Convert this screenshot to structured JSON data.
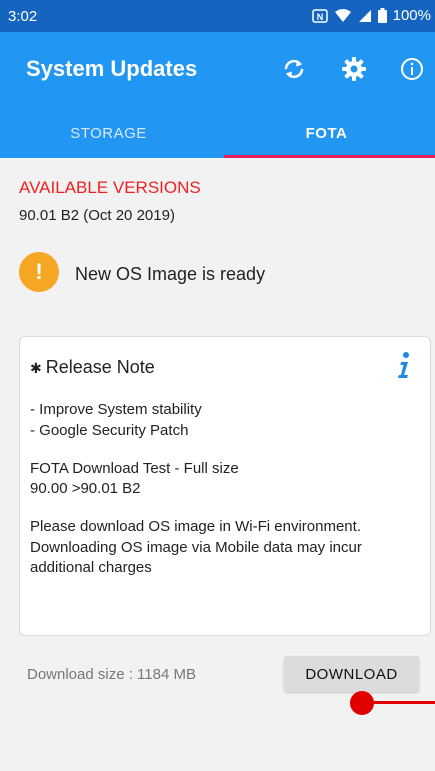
{
  "status_bar": {
    "time": "3:02",
    "battery": "100%"
  },
  "app_bar": {
    "title": "System Updates",
    "icons": [
      "sync-icon",
      "gear-icon",
      "info-icon"
    ]
  },
  "tabs": [
    {
      "label": "STORAGE",
      "active": false
    },
    {
      "label": "FOTA",
      "active": true
    }
  ],
  "available_versions": {
    "heading": "AVAILABLE VERSIONS",
    "version": "90.01 B2 (Oct 20 2019)"
  },
  "alert": {
    "icon": "!",
    "text": "New OS Image is ready"
  },
  "release_note": {
    "title": "Release Note",
    "lines": [
      "- Improve System stability",
      "- Google Security Patch",
      "FOTA Download Test - Full size",
      "90.00 >90.01 B2",
      "Please download OS image in Wi-Fi environment.",
      "Downloading OS image via  Mobile data may incur",
      "additional charges"
    ]
  },
  "download": {
    "size_text": "Download size : 1184 MB",
    "button_label": "DOWNLOAD"
  },
  "colors": {
    "status_bar": "#1565c0",
    "app_bar": "#2196f3",
    "tab_indicator": "#e91e63",
    "heading_red": "#ef1f1f",
    "alert": "#f5a623",
    "info_icon": "#1e88e5"
  }
}
